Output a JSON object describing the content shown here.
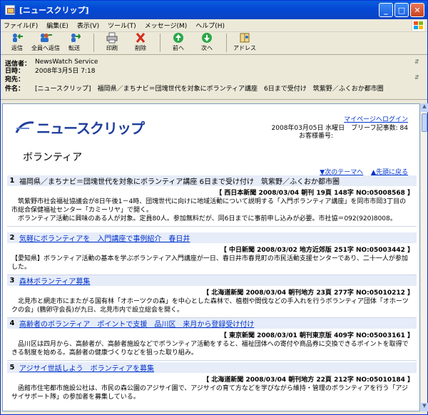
{
  "window": {
    "title": "[ニュースクリップ]"
  },
  "menu": [
    "ファイル(F)",
    "編集(E)",
    "表示(V)",
    "ツール(T)",
    "メッセージ(M)",
    "ヘルプ(H)"
  ],
  "toolbar": {
    "reply": "返信",
    "reply_all": "全員へ返信",
    "forward": "転送",
    "print": "印刷",
    "delete": "削除",
    "prev": "前へ",
    "next": "次へ",
    "address": "アドレス"
  },
  "header": {
    "from_k": "送信者：",
    "from_v": "NewsWatch Service",
    "date_k": "日時：",
    "date_v": "2008年3月5日 7:18",
    "to_k": "宛先：",
    "to_v": "",
    "subject_k": "件名：",
    "subject_v": "[ニュースクリップ]　福岡県／まちナビ＝団塊世代を対象にボランティア講座　6日まで受付け　筑紫野／ふくおか都市圏"
  },
  "content": {
    "logo": "ニュースクリップ",
    "mypage": "マイページへログイン",
    "dateline": "2008年03月05日 水曜日　ブリーフ記事数: 84",
    "custno": "お客様番号:",
    "section": "ボランティア",
    "nav_next": "▼次のテーマへ",
    "nav_top": "▲先頭に戻る"
  },
  "items": [
    {
      "num": "1",
      "title": "福岡県／まちナビ＝団塊世代を対象にボランティア講座 6日まで受け付け　筑紫野／ふくおか都市圏",
      "link": false,
      "source": "【 西日本新聞 2008/03/04 朝刊 19頁 148字 NO:05008568 】",
      "body": "　筑紫野市社会福祉協議会が8日午後1－4時、団塊世代に向けに地域活動について説明する「入門ボランティア講座」を同市市岡3丁目の市総合保健福祉センター「カミーリヤ」で開く。\n　ボランティア活動に興味のある人が対象。定員80人。参加無料だが、同6日までに事前申し込みが必要。市社協＝092(920)8008。"
    },
    {
      "num": "2",
      "title": "気軽にボランティアを　入門講座で事例紹介　春日井",
      "link": true,
      "source": "【 中日新聞 2008/03/02 地方近郊版 251字 NO:05003442 】",
      "body": "【愛知県】ボランティア活動の基本を学ぶボランティア入門講座が一日、春日井市春見町の市民活動支援センターであり、二十一人が参加した。"
    },
    {
      "num": "3",
      "title": "森林ボランティア募集",
      "link": true,
      "source": "【 北海道新聞 2008/03/04 朝刊地方 23頁 277字 NO:05010212 】",
      "body": "　北見市と網走市にまたがる国有林「オホーツクの森」を中心とした森林で、植樹や間伐などの手入れを行うボランティア団体「オホーツクの会」(鶴卵守会長)が九日、北見市内で設立総会を開く。"
    },
    {
      "num": "4",
      "title": "高齢者のボランティア　ポイントで支援　品川区　来月から登録受け付け",
      "link": true,
      "source": "【 東京新聞 2008/03/01 朝刊東京版 409字 NO:05003161 】",
      "body": "　品川区は四月から、高齢者が、高齢者施設などでボランティア活動をすると、福祉団体への寄付や商品券に交換できるポイントを取得できる制度を始める。高齢者の健康づくりなどを狙った取り組み。"
    },
    {
      "num": "5",
      "title": "アジサイ世話しよう　ボランティアを募集",
      "link": true,
      "source": "【 北海道新聞 2008/03/04 朝刊地方 22頁 212字 NO:05010184 】",
      "body": "　函館市住宅都市施設公社は、市民の森公園のアジサイ園で、アジサイの育て方などを学びながら維持・管理のボランティアを行う「アジサイサポート隊」の参加者を募集している。"
    }
  ]
}
